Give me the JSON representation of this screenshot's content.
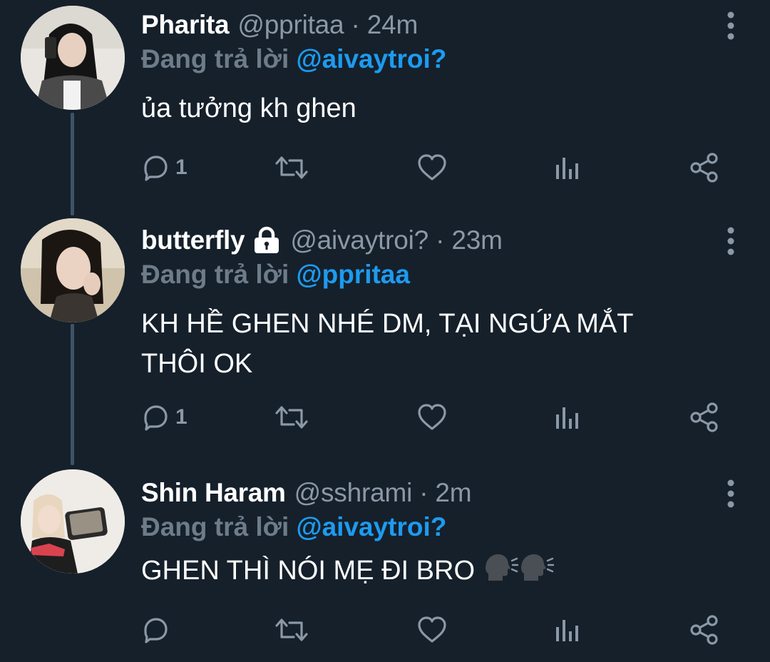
{
  "colors": {
    "background": "#15202b",
    "accent": "#1d9bf0",
    "muted": "#8b98a5",
    "thread_line": "#3d5466"
  },
  "reply_prefix": "Đang trả lời",
  "tweets": [
    {
      "display_name": "Pharita",
      "handle": "@ppritaa",
      "time": "24m",
      "locked": false,
      "reply_to": "@aivaytroi?",
      "text": "ủa tưởng kh ghen",
      "reply_count": "1",
      "icons": [
        "reply-icon",
        "retweet-icon",
        "like-icon",
        "views-icon",
        "share-icon",
        "more-icon"
      ]
    },
    {
      "display_name": "butterfly",
      "handle": "@aivaytroi?",
      "time": "23m",
      "locked": true,
      "reply_to": "@ppritaa",
      "text": "KH HỀ GHEN NHÉ DM, TẠI NGỨA MẮT THÔI OK",
      "reply_count": "1",
      "icons": [
        "reply-icon",
        "retweet-icon",
        "like-icon",
        "views-icon",
        "share-icon",
        "lock-icon"
      ]
    },
    {
      "display_name": "Shin Haram",
      "handle": "@sshrami",
      "time": "2m",
      "locked": false,
      "reply_to": "@aivaytroi?",
      "text": "GHEN THÌ NÓI MẸ ĐI BRO",
      "reply_count": "",
      "icons": [
        "reply-icon",
        "retweet-icon",
        "like-icon",
        "views-icon",
        "share-icon",
        "speaking-head-icon"
      ]
    }
  ]
}
